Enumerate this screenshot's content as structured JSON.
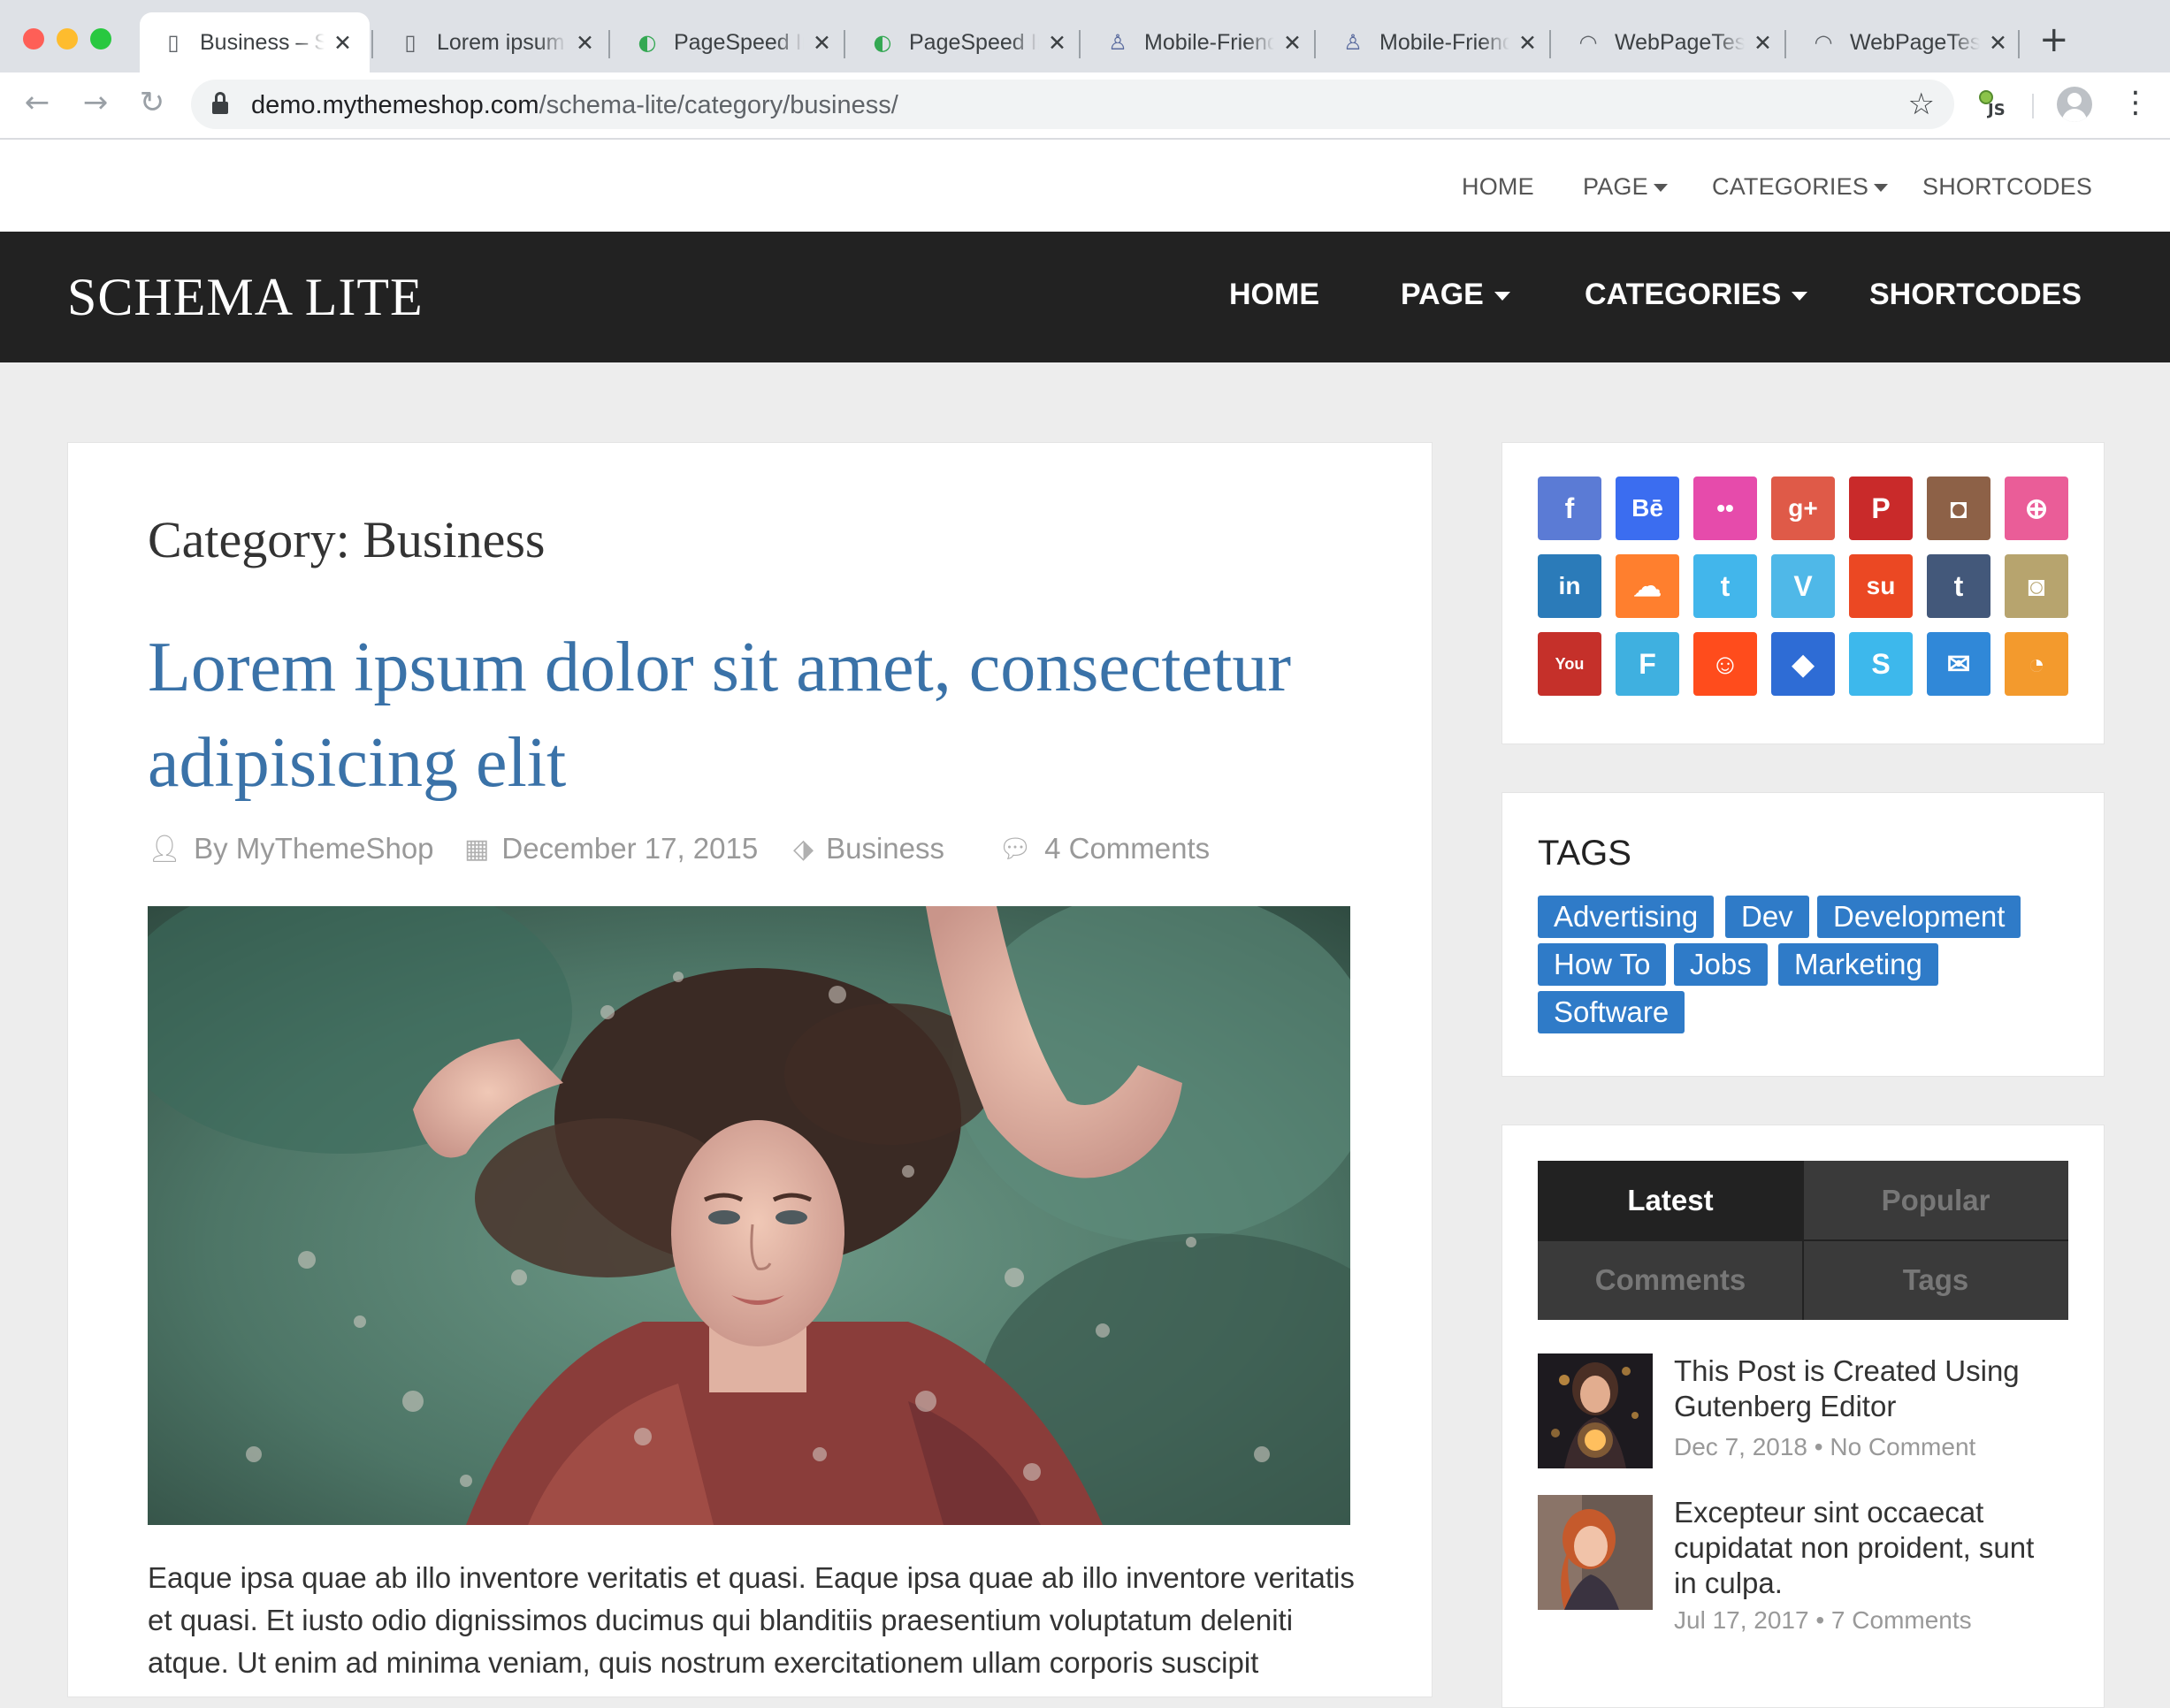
{
  "browser": {
    "tabs": [
      {
        "title": "Business – Schema Lite",
        "icon": "page-icon",
        "active": true
      },
      {
        "title": "Lorem ipsum",
        "icon": "page-icon",
        "active": false
      },
      {
        "title": "PageSpeed Insights",
        "icon": "pagespeed-icon",
        "active": false
      },
      {
        "title": "PageSpeed Insights",
        "icon": "pagespeed-icon",
        "active": false
      },
      {
        "title": "Mobile-Friendly Test",
        "icon": "mobile-friendly-icon",
        "active": false
      },
      {
        "title": "Mobile-Friendly Test",
        "icon": "mobile-friendly-icon",
        "active": false
      },
      {
        "title": "WebPageTest",
        "icon": "speedometer-icon",
        "active": false
      },
      {
        "title": "WebPageTest",
        "icon": "speedometer-icon",
        "active": false
      }
    ],
    "url_host": "demo.mythemeshop.com",
    "url_path": "/schema-lite/category/business/",
    "extension_label": "JS"
  },
  "topnav": {
    "home": "HOME",
    "page": "PAGE",
    "categories": "CATEGORIES",
    "shortcodes": "SHORTCODES"
  },
  "header": {
    "logo": "SCHEMA LITE",
    "nav": {
      "home": "HOME",
      "page": "PAGE",
      "categories": "CATEGORIES",
      "shortcodes": "SHORTCODES"
    }
  },
  "main": {
    "category_title": "Category: Business",
    "post": {
      "title": "Lorem ipsum dolor sit amet, consectetur adipisicing elit",
      "author": "By MyThemeShop",
      "date": "December 17, 2015",
      "category": "Business",
      "comments": "4 Comments",
      "excerpt": "Eaque ipsa quae ab illo inventore veritatis et quasi. Eaque ipsa quae ab illo inventore veritatis et quasi. Et iusto odio dignissimos ducimus qui blanditiis praesentium voluptatum deleniti atque. Ut enim ad minima veniam, quis nostrum exercitationem ullam corporis suscipit"
    }
  },
  "sidebar": {
    "social": [
      {
        "name": "facebook",
        "glyph": "f",
        "color": "#5b7bd5"
      },
      {
        "name": "behance",
        "glyph": "Bē",
        "color": "#3b6df0"
      },
      {
        "name": "flickr",
        "glyph": "••",
        "color": "#e64bab"
      },
      {
        "name": "google-plus",
        "glyph": "g+",
        "color": "#df5a48"
      },
      {
        "name": "pinterest",
        "glyph": "P",
        "color": "#c92a2a"
      },
      {
        "name": "instagram",
        "glyph": "◘",
        "color": "#8d6147"
      },
      {
        "name": "dribbble",
        "glyph": "⊕",
        "color": "#ea5d98"
      },
      {
        "name": "linkedin",
        "glyph": "in",
        "color": "#2b7bb9"
      },
      {
        "name": "soundcloud",
        "glyph": "☁",
        "color": "#ff7f2e"
      },
      {
        "name": "twitter",
        "glyph": "t",
        "color": "#42b6eb"
      },
      {
        "name": "vimeo",
        "glyph": "V",
        "color": "#4fb8e8"
      },
      {
        "name": "stumbleupon",
        "glyph": "su",
        "color": "#eb4823"
      },
      {
        "name": "tumblr",
        "glyph": "t",
        "color": "#43587a"
      },
      {
        "name": "github",
        "glyph": "◙",
        "color": "#b7a46e"
      },
      {
        "name": "youtube",
        "glyph": "You",
        "color": "#c5302a"
      },
      {
        "name": "foursquare",
        "glyph": "F",
        "color": "#3fb0e0"
      },
      {
        "name": "reddit",
        "glyph": "☺",
        "color": "#ff4c1c"
      },
      {
        "name": "dropbox",
        "glyph": "◆",
        "color": "#2e6cd5"
      },
      {
        "name": "skype",
        "glyph": "S",
        "color": "#3db8ec"
      },
      {
        "name": "email",
        "glyph": "✉",
        "color": "#3088d8"
      },
      {
        "name": "rss",
        "glyph": "◔",
        "color": "#f39a2d"
      }
    ],
    "tags_title": "TAGS",
    "tags": [
      "Advertising",
      "Dev",
      "Development",
      "How To",
      "Jobs",
      "Marketing",
      "Software"
    ],
    "tabs": {
      "latest": "Latest",
      "popular": "Popular",
      "comments": "Comments",
      "tags": "Tags"
    },
    "posts": [
      {
        "title": "This Post is Created Using Gutenberg Editor",
        "meta": "Dec 7, 2018 • No Comment"
      },
      {
        "title": "Excepteur sint occaecat cupidatat non proident, sunt in culpa.",
        "meta": "Jul 17, 2017 • 7 Comments"
      }
    ]
  }
}
